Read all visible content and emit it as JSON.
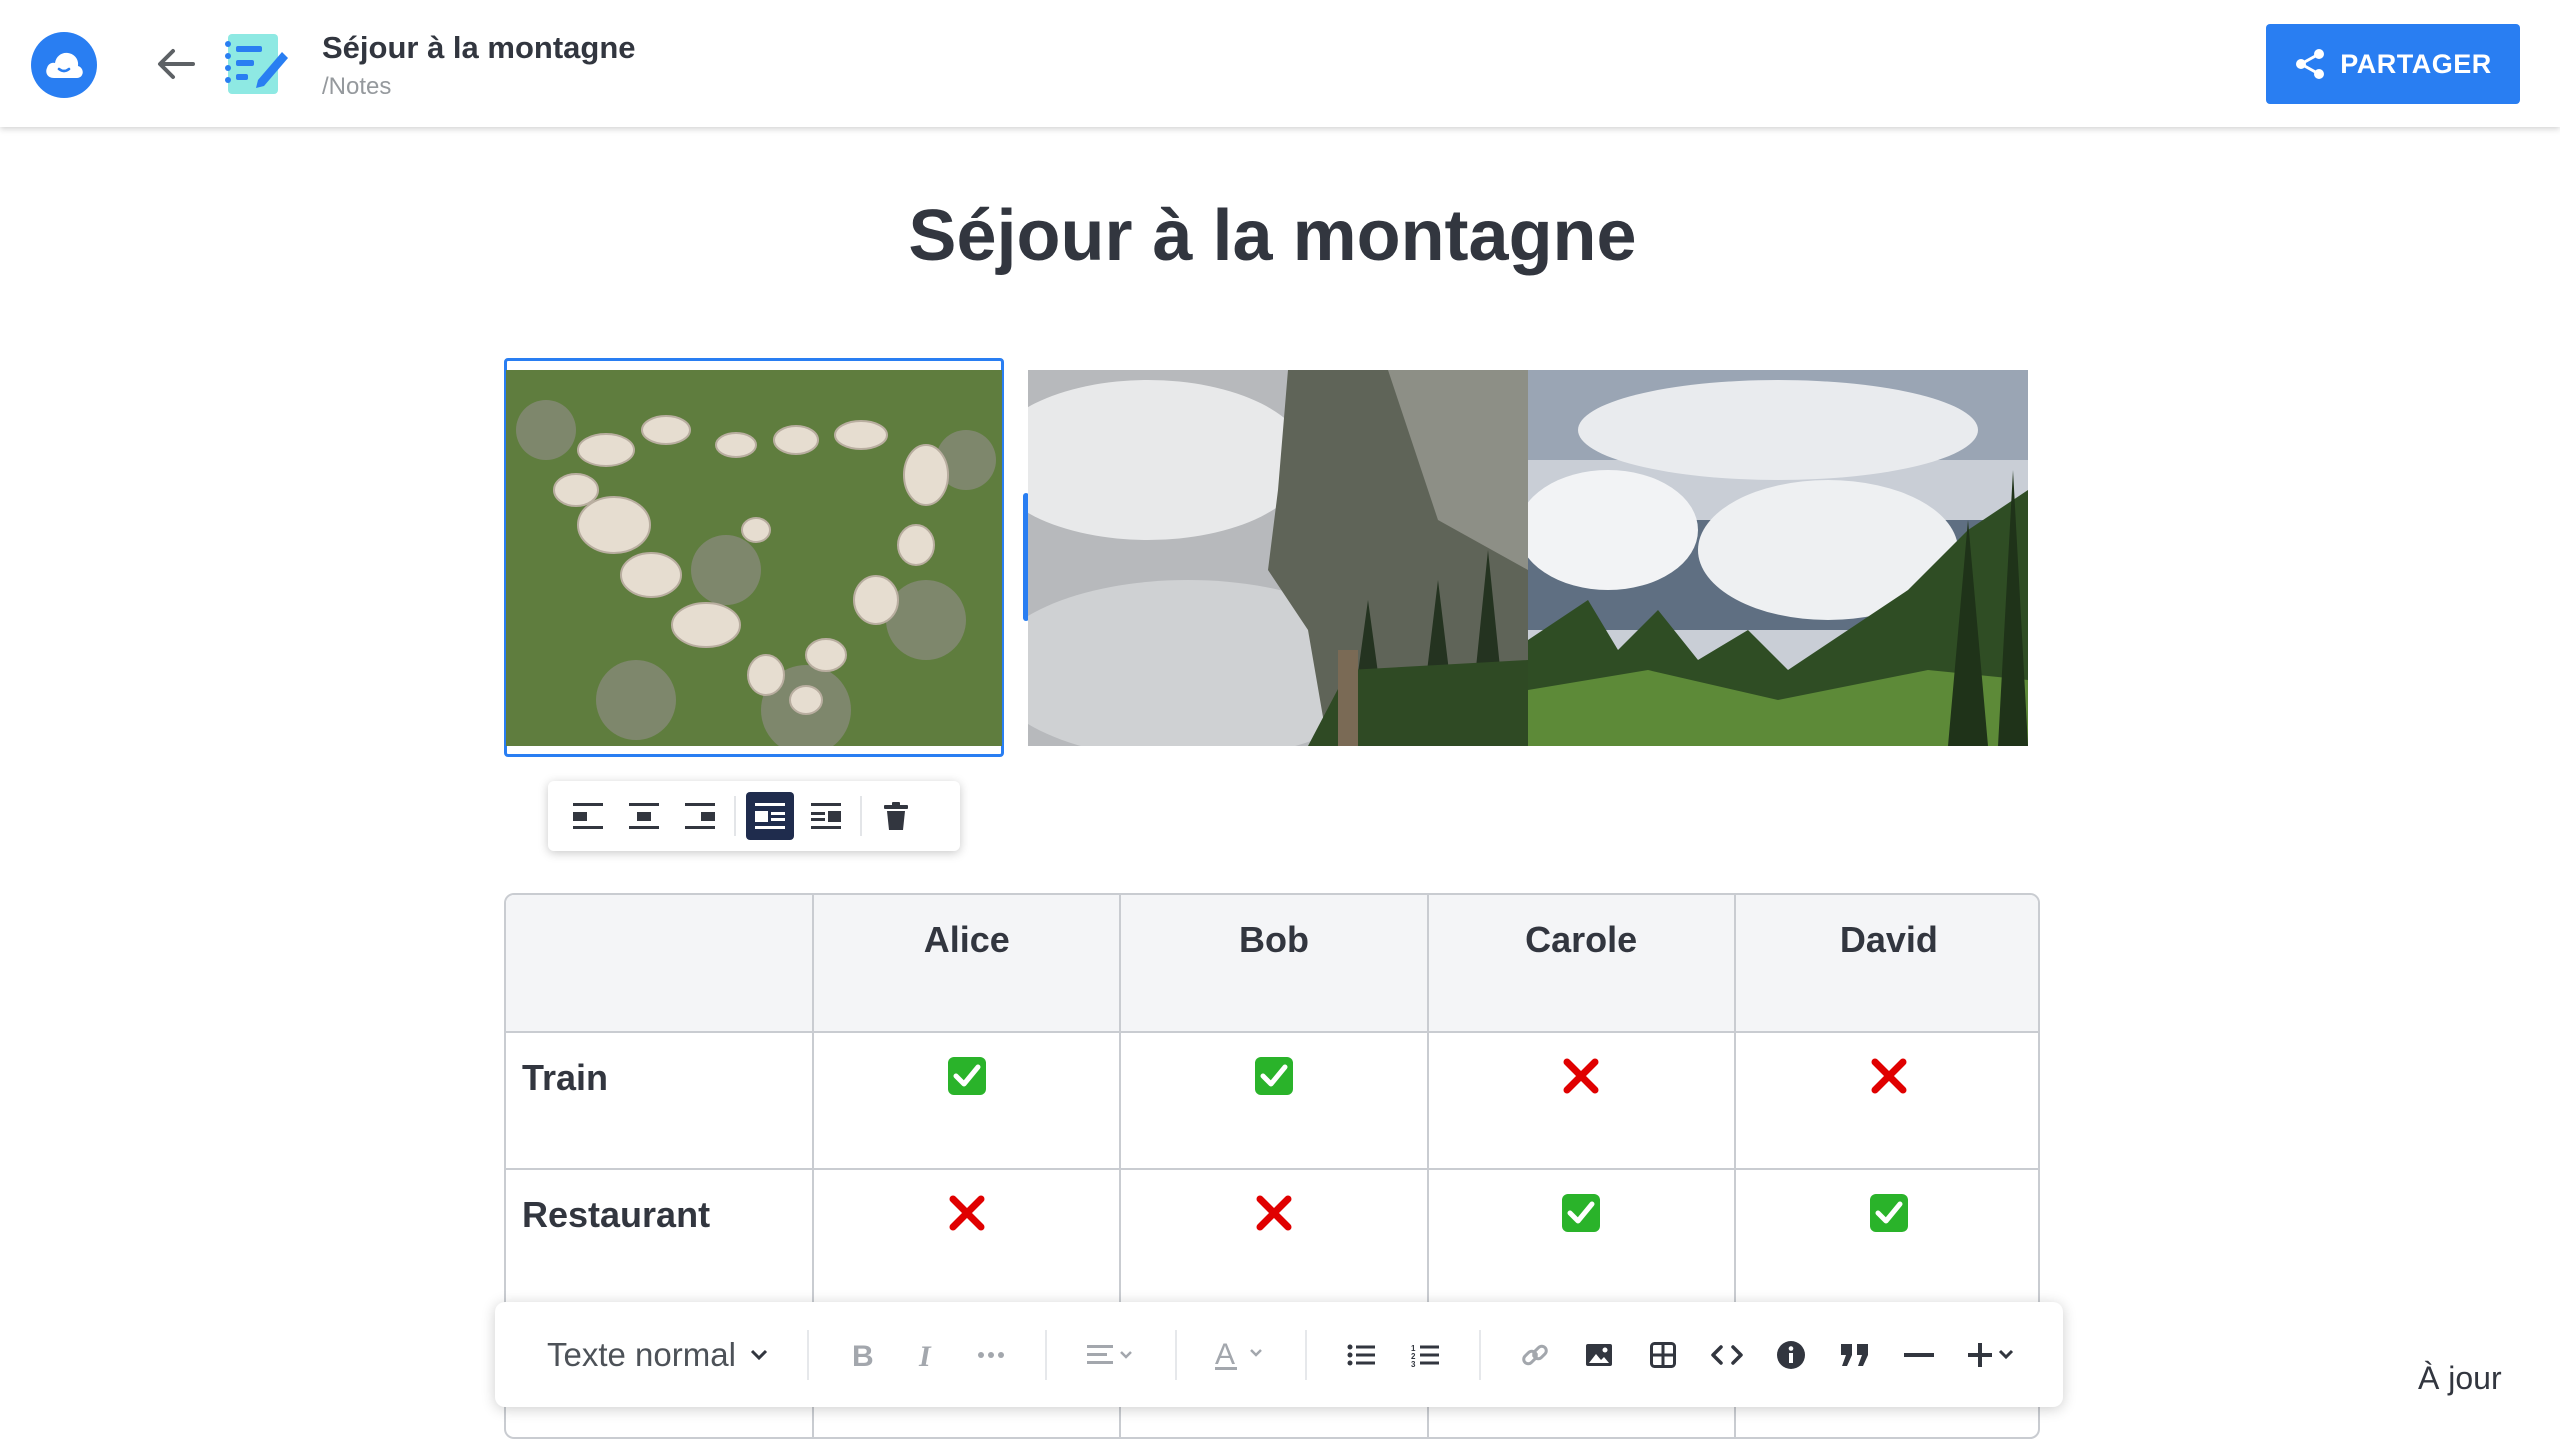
{
  "header": {
    "doc_title": "Séjour à la montagne",
    "doc_path": "/Notes",
    "share_label": "PARTAGER"
  },
  "document": {
    "title": "Séjour à la montagne"
  },
  "image_toolbar": {
    "buttons": [
      "align-left",
      "align-center",
      "align-right",
      "wrap-left",
      "wrap-right",
      "delete"
    ],
    "active": "wrap-left"
  },
  "table": {
    "columns": [
      "",
      "Alice",
      "Bob",
      "Carole",
      "David"
    ],
    "rows": [
      {
        "label": "Train",
        "values": [
          "yes",
          "yes",
          "no",
          "no"
        ]
      },
      {
        "label": "Restaurant",
        "values": [
          "no",
          "no",
          "yes",
          "yes"
        ]
      }
    ]
  },
  "format_toolbar": {
    "text_style": "Texte normal"
  },
  "status": "À jour",
  "colors": {
    "primary": "#297ef2",
    "check_green": "#2ab32a",
    "cross_red": "#e00000",
    "text": "#32363f"
  }
}
